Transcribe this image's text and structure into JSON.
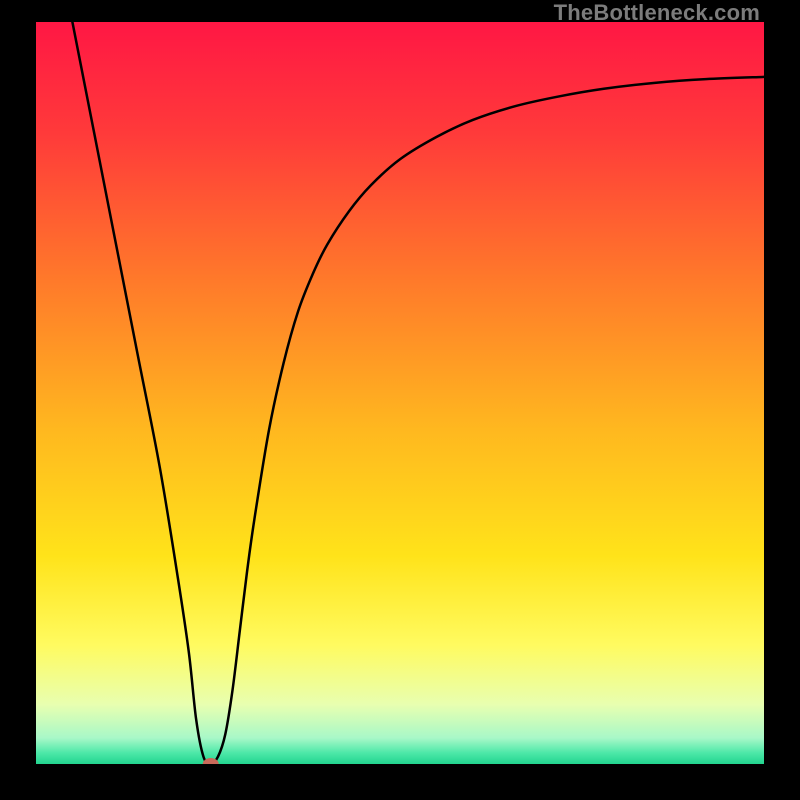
{
  "watermark": "TheBottleneck.com",
  "chart_data": {
    "type": "line",
    "title": "",
    "xlabel": "",
    "ylabel": "",
    "xlim": [
      0,
      100
    ],
    "ylim": [
      0,
      100
    ],
    "background_gradient": {
      "stops": [
        {
          "offset": 0.0,
          "color": "#ff1744"
        },
        {
          "offset": 0.15,
          "color": "#ff3a3a"
        },
        {
          "offset": 0.35,
          "color": "#ff7a2a"
        },
        {
          "offset": 0.55,
          "color": "#ffb81f"
        },
        {
          "offset": 0.72,
          "color": "#ffe31a"
        },
        {
          "offset": 0.84,
          "color": "#fffb60"
        },
        {
          "offset": 0.92,
          "color": "#e8ffb0"
        },
        {
          "offset": 0.965,
          "color": "#a8f8c8"
        },
        {
          "offset": 0.985,
          "color": "#4de8a8"
        },
        {
          "offset": 1.0,
          "color": "#22d48f"
        }
      ]
    },
    "series": [
      {
        "name": "bottleneck-curve",
        "color": "#000000",
        "linewidth": 2.5,
        "x": [
          5,
          8,
          11,
          14,
          17,
          19.5,
          21,
          22,
          23,
          24,
          25,
          26,
          27,
          28,
          29,
          30,
          32,
          34,
          36,
          38,
          40,
          43,
          46,
          50,
          55,
          60,
          66,
          72,
          78,
          85,
          92,
          100
        ],
        "y": [
          100,
          85,
          70,
          55,
          40,
          25,
          15,
          6,
          1,
          0,
          1,
          4,
          10,
          18,
          26,
          33,
          45,
          54,
          61,
          66,
          70,
          74.5,
          78,
          81.5,
          84.5,
          86.8,
          88.7,
          90.0,
          91.0,
          91.8,
          92.3,
          92.6
        ]
      }
    ],
    "marker": {
      "name": "optimal-point",
      "x": 24,
      "y": 0,
      "color": "#c96a5a",
      "rx": 8,
      "ry": 6
    }
  }
}
